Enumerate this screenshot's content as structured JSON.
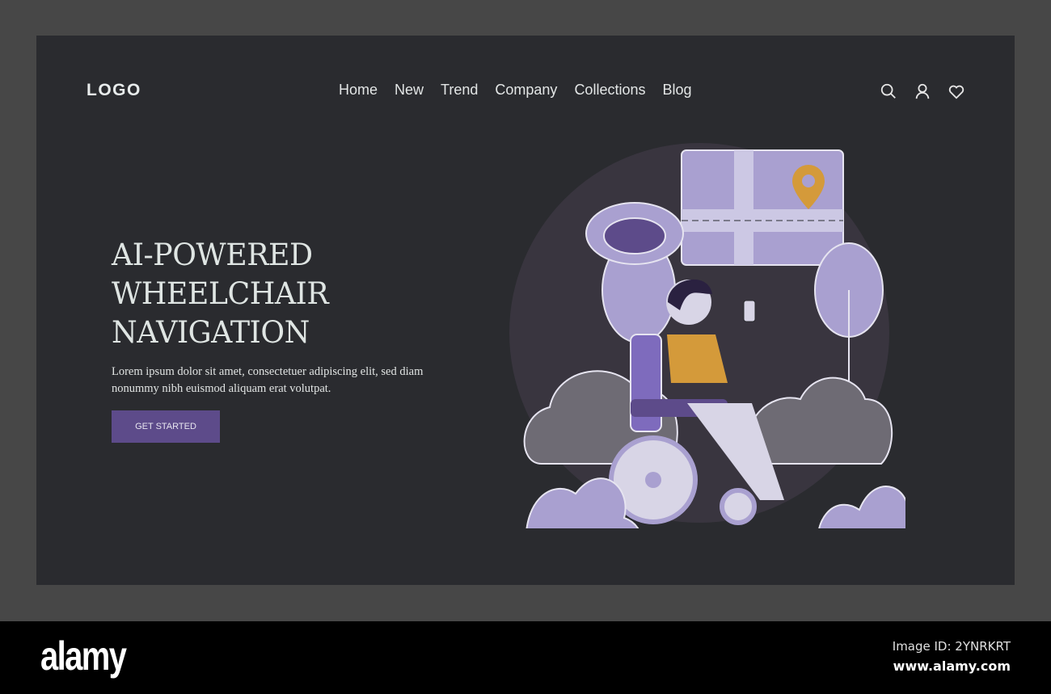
{
  "header": {
    "logo": "LOGO",
    "nav": [
      "Home",
      "New",
      "Trend",
      "Company",
      "Collections",
      "Blog"
    ]
  },
  "hero": {
    "title_lines": [
      "AI-POWERED",
      "WHEELCHAIR",
      "NAVIGATION"
    ],
    "body": "Lorem ipsum dolor sit amet, consectetuer adipiscing elit, sed diam nonummy nibh euismod aliquam erat volutpat.",
    "cta": "GET STARTED"
  },
  "colors": {
    "accent": "#5d4b8a",
    "lavender": "#a9a0d0",
    "card": "#2a2b2f"
  },
  "footer": {
    "brand": "alamy",
    "image_id": "Image ID: 2YNRKRT",
    "url": "www.alamy.com"
  }
}
